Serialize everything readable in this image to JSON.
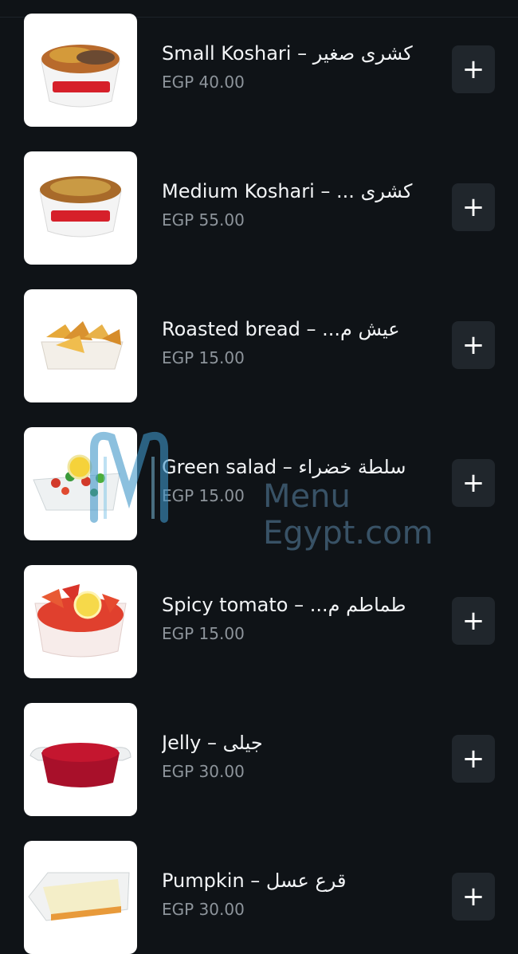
{
  "menu_items": [
    {
      "name": "Small Koshari – كشرى صغير",
      "price": "EGP 40.00",
      "add_label": "+"
    },
    {
      "name": "Medium Koshari – ... كشرى",
      "price": "EGP 55.00",
      "add_label": "+"
    },
    {
      "name": "Roasted bread – ...عيش م",
      "price": "EGP 15.00",
      "add_label": "+"
    },
    {
      "name": "Green salad – سلطة خضراء",
      "price": "EGP 15.00",
      "add_label": "+"
    },
    {
      "name": "Spicy tomato – ...طماطم م",
      "price": "EGP 15.00",
      "add_label": "+"
    },
    {
      "name": "Jelly – جيلى",
      "price": "EGP 30.00",
      "add_label": "+"
    },
    {
      "name": "Pumpkin – قرع عسل",
      "price": "EGP 30.00",
      "add_label": "+"
    }
  ],
  "watermark": {
    "text": "Menu Egypt.com"
  },
  "icons": {
    "add": "plus-icon"
  },
  "colors": {
    "background": "#0f1317",
    "button": "#20262c",
    "price": "#8d949b"
  }
}
